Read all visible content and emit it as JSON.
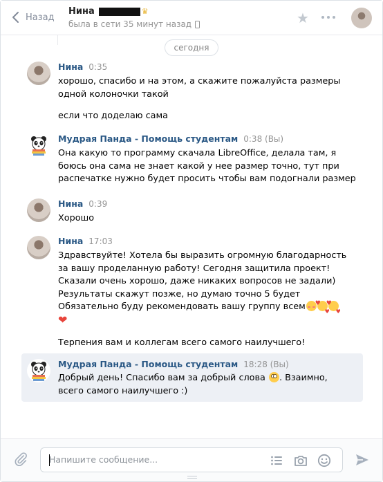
{
  "header": {
    "back_label": "Назад",
    "peer_name": "Нина",
    "status": "была в сети 35 минут назад"
  },
  "day_label": "сегодня",
  "messages": [
    {
      "author": "Нина",
      "time": "0:35",
      "avatar": "woman",
      "lines": [
        "хорошо, спасибо и на этом, а скажите пожалуйста размеры",
        "одной колоночки такой",
        "",
        "если что доделаю сама"
      ]
    },
    {
      "author": "Мудрая Панда - Помощь студентам",
      "time": "0:38 (Вы)",
      "avatar": "panda",
      "lines": [
        "Она какую то программу скачала LibreOffice, делала там, я",
        "боюсь она сама не знает какой у нее размер точно, тут при",
        "распечатке нужно будет просить чтобы вам подогнали размер"
      ]
    },
    {
      "author": "Нина",
      "time": "0:39",
      "avatar": "woman",
      "lines": [
        "Хорошо"
      ]
    },
    {
      "author": "Нина",
      "time": "17:03",
      "avatar": "woman",
      "lines": [
        "Здравствуйте! Хотела бы выразить огромную благодарность",
        "за вашу проделанную работу! Сегодня защитила проект!",
        "Сказали очень хорошо, даже никаких вопросов не задали)",
        "Результаты скажут позже, но думаю точно 5 будет",
        "Обязательно буду рекомендовать вашу группу всем",
        "",
        "",
        "Терпения вам и коллегам всего самого наилучшего!"
      ]
    },
    {
      "author": "Мудрая Панда - Помощь студентам",
      "time": "18:28 (Вы)",
      "avatar": "panda",
      "lines": [
        "Добрый день! Спасибо вам за добрый слова",
        "всего самого наилучшего :)"
      ],
      "line1_suffix": ". Взаимно,"
    }
  ],
  "composer": {
    "placeholder": "Напишите сообщение..."
  },
  "colors": {
    "author_link": "#2a5885",
    "highlight_bg": "#edf0f5",
    "muted": "#939393"
  }
}
